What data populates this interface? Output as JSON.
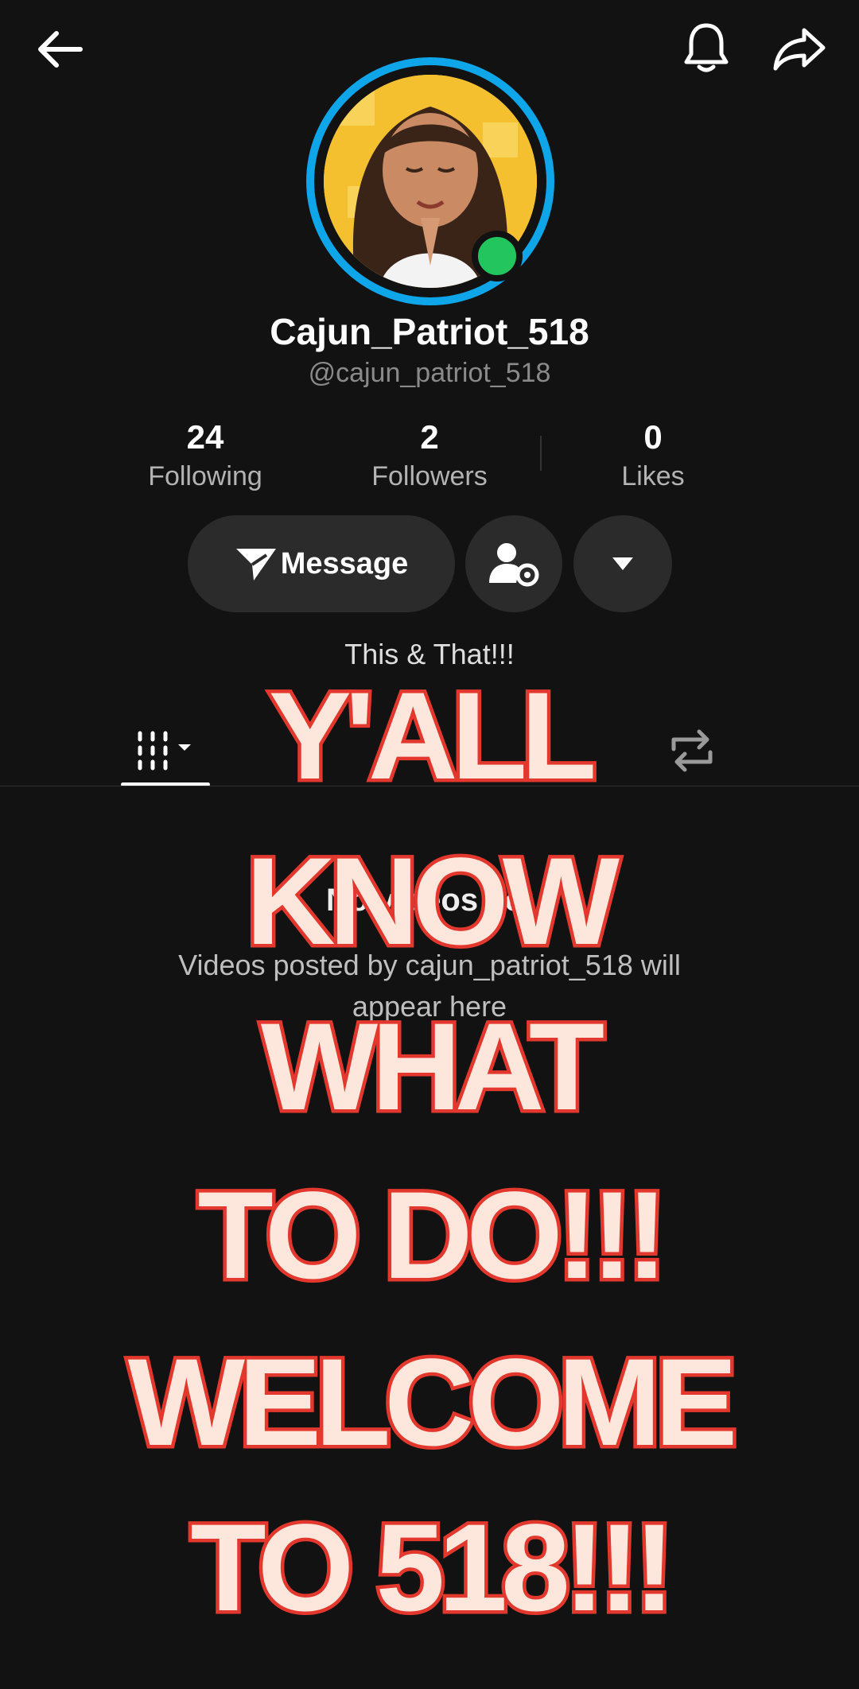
{
  "header": {
    "back_icon": "arrow-left-icon",
    "bell_icon": "bell-icon",
    "share_icon": "share-arrow-icon"
  },
  "profile": {
    "display_name": "Cajun_Patriot_518",
    "username": "@cajun_patriot_518",
    "bio": "This & That!!!",
    "online": true
  },
  "stats": [
    {
      "value": "24",
      "label": "Following"
    },
    {
      "value": "2",
      "label": "Followers"
    },
    {
      "value": "0",
      "label": "Likes"
    }
  ],
  "actions": {
    "message_label": "Message"
  },
  "tabs": {
    "videos_icon": "grid-icon",
    "reposts_icon": "repost-icon"
  },
  "empty_state": {
    "title": "No videos yet",
    "description": "Videos posted by cajun_patriot_518 will appear here"
  },
  "overlay_caption": [
    "Y'ALL",
    "KNOW",
    "WHAT",
    "TO DO!!!",
    "WELCOME",
    "TO 518!!!"
  ],
  "colors": {
    "background": "#121212",
    "ring": "#0ea5e9",
    "online": "#22c55e",
    "caption_fill": "#fde6dc",
    "caption_stroke": "#e3382e"
  }
}
